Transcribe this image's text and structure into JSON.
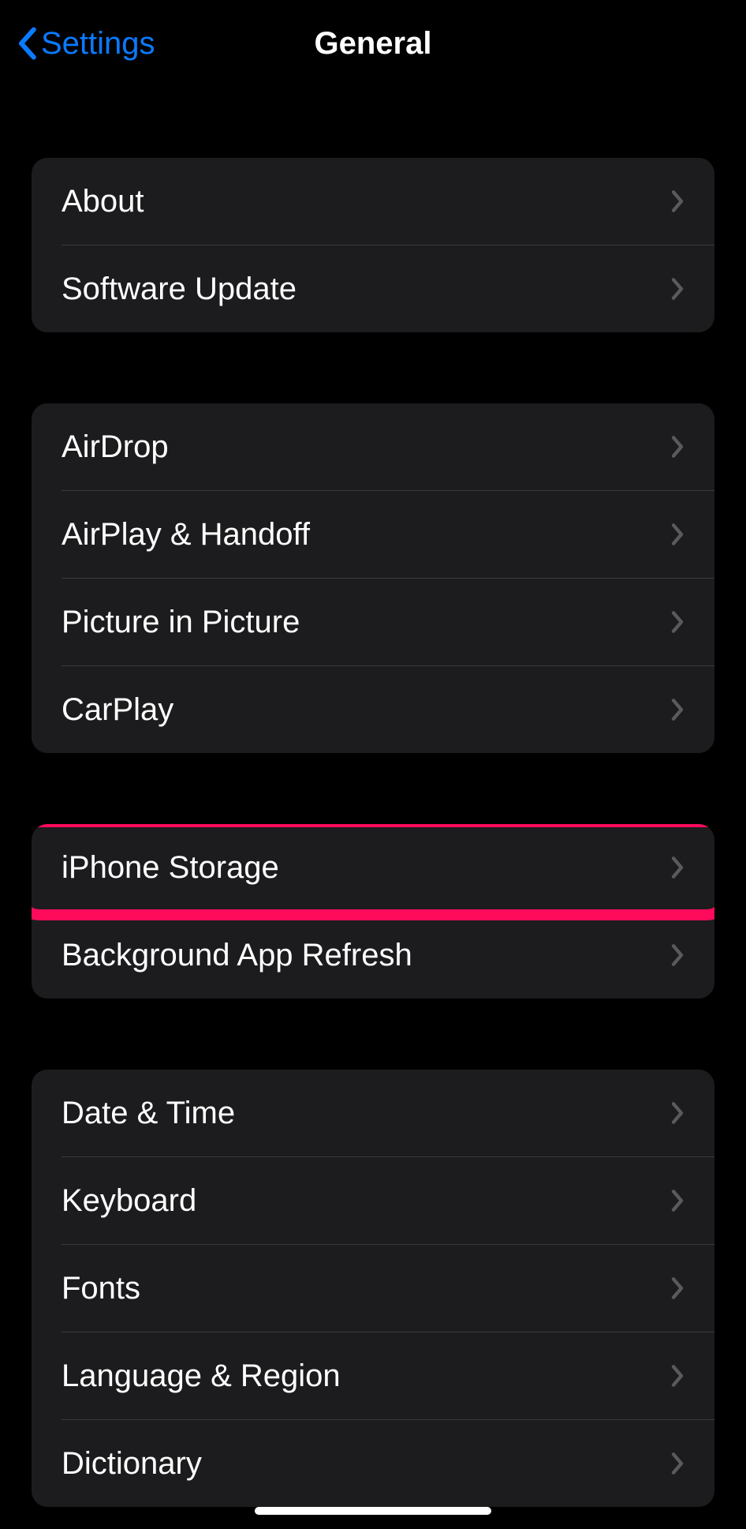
{
  "nav": {
    "back_label": "Settings",
    "title": "General"
  },
  "sections": [
    {
      "items": [
        {
          "label": "About",
          "name": "about"
        },
        {
          "label": "Software Update",
          "name": "software-update"
        }
      ]
    },
    {
      "items": [
        {
          "label": "AirDrop",
          "name": "airdrop"
        },
        {
          "label": "AirPlay & Handoff",
          "name": "airplay-handoff"
        },
        {
          "label": "Picture in Picture",
          "name": "picture-in-picture"
        },
        {
          "label": "CarPlay",
          "name": "carplay"
        }
      ]
    },
    {
      "items": [
        {
          "label": "iPhone Storage",
          "name": "iphone-storage",
          "highlighted": true
        },
        {
          "label": "Background App Refresh",
          "name": "background-app-refresh"
        }
      ]
    },
    {
      "items": [
        {
          "label": "Date & Time",
          "name": "date-time"
        },
        {
          "label": "Keyboard",
          "name": "keyboard"
        },
        {
          "label": "Fonts",
          "name": "fonts"
        },
        {
          "label": "Language & Region",
          "name": "language-region"
        },
        {
          "label": "Dictionary",
          "name": "dictionary"
        }
      ]
    }
  ]
}
